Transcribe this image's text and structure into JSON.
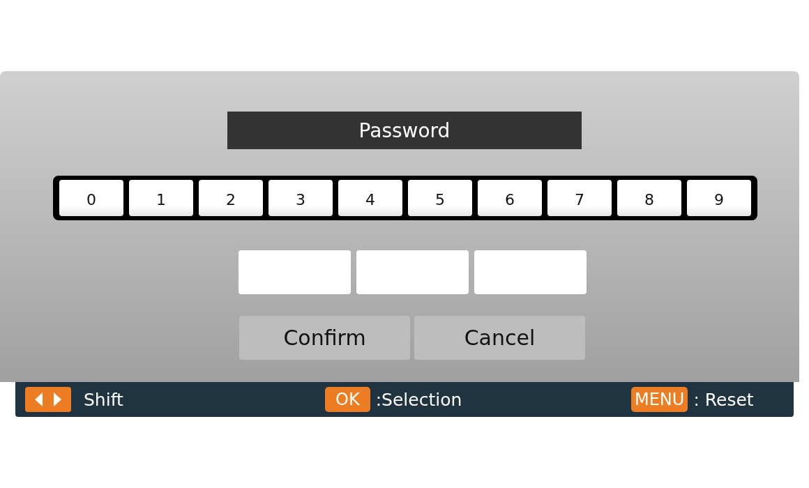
{
  "dialog": {
    "title": "Password",
    "keypad": [
      "0",
      "1",
      "2",
      "3",
      "4",
      "5",
      "6",
      "7",
      "8",
      "9"
    ],
    "entry_boxes": [
      {
        "kind": "empty"
      },
      {
        "kind": "empty"
      },
      {
        "kind": "empty"
      }
    ],
    "buttons": [
      "Confirm",
      "Cancel"
    ]
  },
  "help_bar": [
    {
      "kind": "arrows",
      "text": "Shift"
    },
    {
      "kind": "key",
      "key": "OK",
      "text": ":Selection"
    },
    {
      "kind": "key",
      "key": "MENU",
      "text": ": Reset"
    }
  ]
}
